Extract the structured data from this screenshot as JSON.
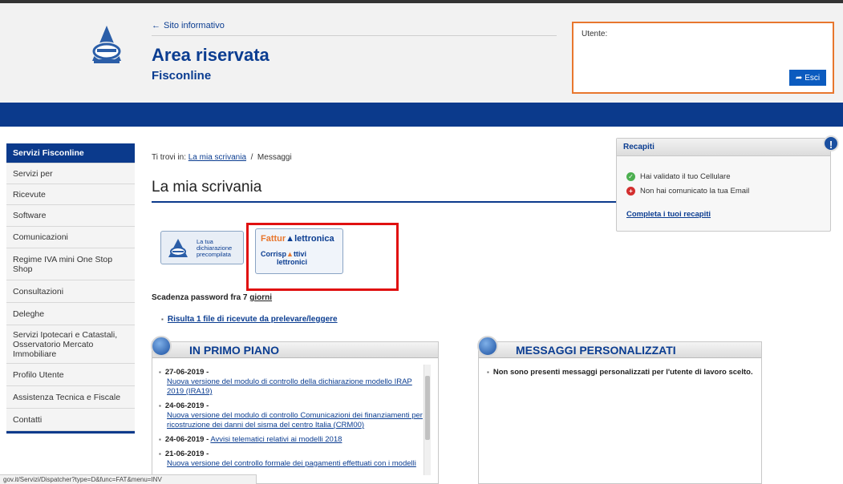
{
  "header": {
    "back_link": "Sito informativo",
    "title": "Area riservata",
    "subtitle": "Fisconline",
    "user_label": "Utente:",
    "logout_label": "Esci"
  },
  "sidebar": {
    "items": [
      {
        "label": "Servizi Fisconline",
        "active": true
      },
      {
        "label": "Servizi per"
      },
      {
        "label": "Ricevute"
      },
      {
        "label": "Software"
      },
      {
        "label": "Comunicazioni"
      },
      {
        "label": "Regime IVA mini One Stop Shop"
      },
      {
        "label": "Consultazioni"
      },
      {
        "label": "Deleghe"
      },
      {
        "label": "Servizi Ipotecari e Catastali, Osservatorio Mercato Immobiliare"
      },
      {
        "label": "Profilo Utente"
      },
      {
        "label": "Assistenza Tecnica e Fiscale"
      },
      {
        "label": "Contatti"
      }
    ]
  },
  "breadcrumb": {
    "prefix": "Ti trovi in:",
    "link": "La mia scrivania",
    "sep": "/",
    "current": "Messaggi"
  },
  "page_title": "La mia scrivania",
  "badges": {
    "precompilata": "La tua dichiarazione precompilata",
    "fe_prefix": "Fattur",
    "fe_suffix": "lettronica",
    "corr_prefix": "Corrisp",
    "corr_mid": "ttivi",
    "corr_suffix": "lettronici"
  },
  "password_notice": "Scadenza password fra 7",
  "password_notice_tail": "giorni",
  "receipts_link": "Risulta 1 file di ricevute da prelevare/leggere",
  "primo_piano": {
    "title": "IN PRIMO PIANO",
    "items": [
      {
        "date": "27-06-2019 -",
        "link": "Nuova versione del modulo di controllo della dichiarazione modello IRAP 2019 (IRA19)"
      },
      {
        "date": "24-06-2019 -",
        "link": "Nuova versione del modulo di controllo Comunicazioni dei finanziamenti per ricostruzione dei danni del sisma del centro Italia (CRM00)"
      },
      {
        "date": "24-06-2019 -",
        "link": "Avvisi telematici relativi ai modelli 2018",
        "inline": true
      },
      {
        "date": "21-06-2019 -",
        "link": "Nuova versione del controllo formale dei pagamenti effettuati con i modelli"
      }
    ]
  },
  "messaggi": {
    "title": "MESSAGGI PERSONALIZZATI",
    "text": "Non sono presenti messaggi personalizzati per l'utente di lavoro scelto."
  },
  "recapiti": {
    "title": "Recapiti",
    "row_ok": "Hai validato il tuo Cellulare",
    "row_err": "Non hai comunicato la tua Email",
    "link": "Completa i tuoi recapiti"
  },
  "status_url": "gov.it/Servizi/Dispatcher?type=D&func=FAT&menu=INV"
}
